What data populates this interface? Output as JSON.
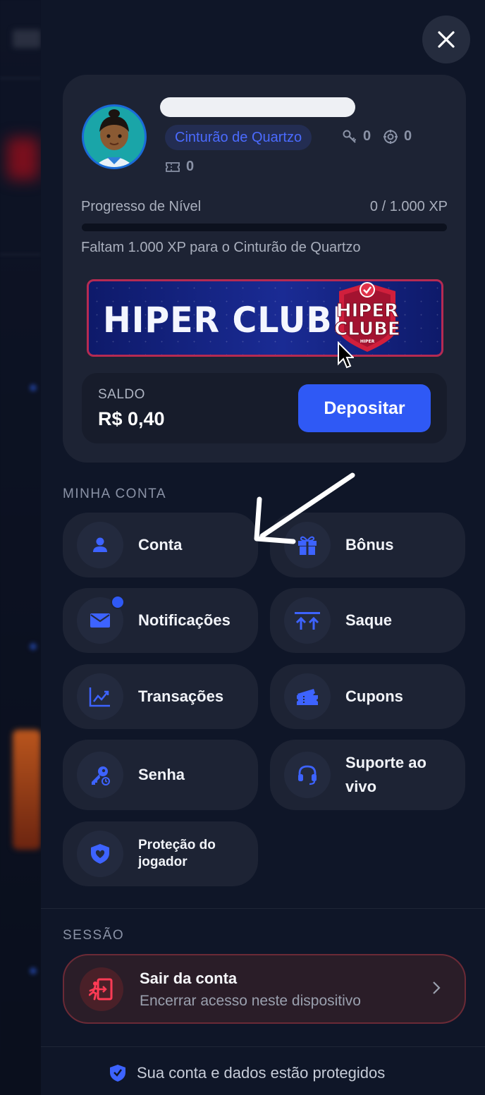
{
  "header": {
    "close_label": "close"
  },
  "profile": {
    "tier": "Cinturão de Quartzo",
    "keys": "0",
    "gems": "0",
    "tickets": "0",
    "progress_label": "Progresso de Nível",
    "progress_value": "0 / 1.000 XP",
    "progress_fraction": 0,
    "progress_hint": "Faltam 1.000 XP para o Cinturão de Quartzo"
  },
  "banner": {
    "text": "HIPER CLUBE",
    "logo_line1": "HIPER",
    "logo_line2": "CLUBE",
    "logo_small": "HIPER"
  },
  "balance": {
    "label": "SALDO",
    "value": "R$ 0,40",
    "deposit_label": "Depositar"
  },
  "account": {
    "title": "MINHA CONTA",
    "items": [
      {
        "label": "Conta",
        "icon": "user-icon"
      },
      {
        "label": "Bônus",
        "icon": "gift-icon"
      },
      {
        "label": "Notificações",
        "icon": "mail-icon"
      },
      {
        "label": "Saque",
        "icon": "withdraw-icon"
      },
      {
        "label": "Transações",
        "icon": "chart-icon"
      },
      {
        "label": "Cupons",
        "icon": "ticket-icon"
      },
      {
        "label": "Senha",
        "icon": "key-icon"
      },
      {
        "label": "Suporte ao vivo",
        "icon": "headset-icon"
      },
      {
        "label": "Proteção do jogador",
        "icon": "shield-heart-icon"
      }
    ]
  },
  "session": {
    "title": "SESSÃO",
    "logout_title": "Sair da conta",
    "logout_sub": "Encerrar acesso neste dispositivo"
  },
  "footer": {
    "text": "Sua conta e dados estão protegidos"
  },
  "colors": {
    "accent": "#2f59f5",
    "tier": "#4b6bff",
    "danger": "#e0314a"
  }
}
